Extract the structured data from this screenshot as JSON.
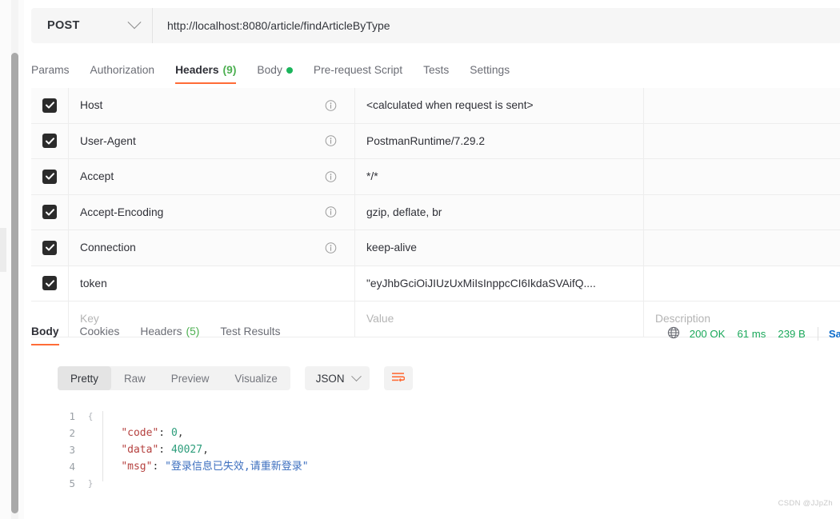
{
  "request": {
    "method": "POST",
    "url": "http://localhost:8080/article/findArticleByType",
    "tabs": [
      {
        "label": "Params",
        "active": false
      },
      {
        "label": "Authorization",
        "active": false
      },
      {
        "label": "Headers",
        "count": "(9)",
        "active": true
      },
      {
        "label": "Body",
        "dot": true,
        "active": false
      },
      {
        "label": "Pre-request Script",
        "active": false
      },
      {
        "label": "Tests",
        "active": false
      },
      {
        "label": "Settings",
        "active": false
      }
    ]
  },
  "headers_table": {
    "columns": {
      "key": "Key",
      "value": "Value",
      "description": "Description"
    },
    "rows": [
      {
        "checked": true,
        "key": "Host",
        "info": true,
        "value": "<calculated when request is sent>",
        "description": ""
      },
      {
        "checked": true,
        "key": "User-Agent",
        "info": true,
        "value": "PostmanRuntime/7.29.2",
        "description": ""
      },
      {
        "checked": true,
        "key": "Accept",
        "info": true,
        "value": "*/*",
        "description": ""
      },
      {
        "checked": true,
        "key": "Accept-Encoding",
        "info": true,
        "value": "gzip, deflate, br",
        "description": ""
      },
      {
        "checked": true,
        "key": "Connection",
        "info": true,
        "value": "keep-alive",
        "description": ""
      },
      {
        "checked": true,
        "key": "token",
        "info": false,
        "value": "\"eyJhbGciOiJIUzUxMiIsInppcCI6IkdaSVAifQ....",
        "description": ""
      }
    ]
  },
  "response": {
    "tabs": [
      {
        "label": "Body",
        "active": true
      },
      {
        "label": "Cookies",
        "active": false
      },
      {
        "label": "Headers",
        "count": "(5)",
        "active": false
      },
      {
        "label": "Test Results",
        "active": false
      }
    ],
    "status": {
      "code": "200 OK",
      "time": "61 ms",
      "size": "239 B",
      "save_label": "Sa"
    },
    "view_modes": [
      {
        "label": "Pretty",
        "active": true
      },
      {
        "label": "Raw",
        "active": false
      },
      {
        "label": "Preview",
        "active": false
      },
      {
        "label": "Visualize",
        "active": false
      }
    ],
    "format": "JSON",
    "body_lines": [
      {
        "no": "1",
        "fold": "{",
        "segments": []
      },
      {
        "no": "2",
        "fold": "",
        "segments": [
          {
            "t": "    ",
            "c": "tok-punct"
          },
          {
            "t": "\"code\"",
            "c": "tok-key"
          },
          {
            "t": ": ",
            "c": "tok-punct"
          },
          {
            "t": "0",
            "c": "tok-num"
          },
          {
            "t": ",",
            "c": "tok-punct"
          }
        ]
      },
      {
        "no": "3",
        "fold": "",
        "segments": [
          {
            "t": "    ",
            "c": "tok-punct"
          },
          {
            "t": "\"data\"",
            "c": "tok-key"
          },
          {
            "t": ": ",
            "c": "tok-punct"
          },
          {
            "t": "40027",
            "c": "tok-num"
          },
          {
            "t": ",",
            "c": "tok-punct"
          }
        ]
      },
      {
        "no": "4",
        "fold": "",
        "segments": [
          {
            "t": "    ",
            "c": "tok-punct"
          },
          {
            "t": "\"msg\"",
            "c": "tok-key"
          },
          {
            "t": ": ",
            "c": "tok-punct"
          },
          {
            "t": "\"登录信息已失效,请重新登录\"",
            "c": "tok-str"
          }
        ]
      },
      {
        "no": "5",
        "fold": "}",
        "segments": []
      }
    ]
  },
  "watermark": "CSDN @JJpZh",
  "colors": {
    "accent": "#ff6c37",
    "success": "#1aa85a",
    "link": "#0b6bcb",
    "count": "#4caf50"
  }
}
